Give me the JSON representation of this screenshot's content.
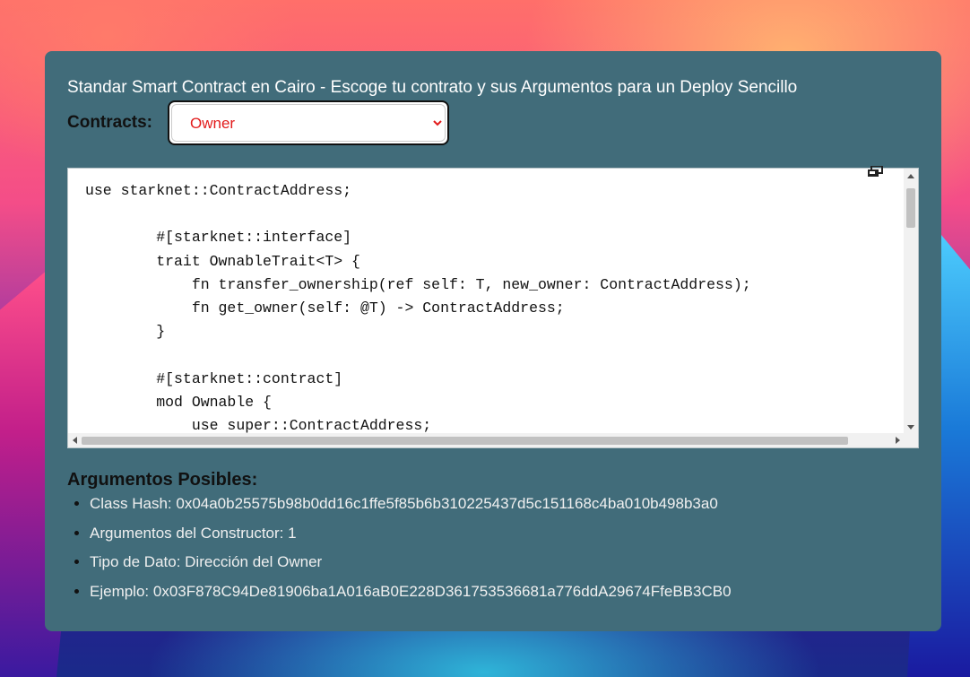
{
  "header": {
    "title": "Standar Smart Contract en Cairo - Escoge tu contrato y sus Argumentos para un Deploy Sencillo"
  },
  "contracts": {
    "label": "Contracts:",
    "selected": "Owner",
    "selected_color": "#e21b1b"
  },
  "code": {
    "text": "use starknet::ContractAddress;\n\n        #[starknet::interface]\n        trait OwnableTrait<T> {\n            fn transfer_ownership(ref self: T, new_owner: ContractAddress);\n            fn get_owner(self: @T) -> ContractAddress;\n        }\n\n        #[starknet::contract]\n        mod Ownable {\n            use super::ContractAddress;",
    "copy_icon": "copy-icon"
  },
  "args": {
    "title": "Argumentos Posibles:",
    "items": [
      "Class Hash: 0x04a0b25575b98b0dd16c1ffe5f85b6b310225437d5c151168c4ba010b498b3a0",
      "Argumentos del Constructor: 1",
      "Tipo de Dato: Dirección del Owner",
      "Ejemplo: 0x03F878C94De81906ba1A016aB0E228D361753536681a776ddA29674FfeBB3CB0"
    ]
  },
  "colors": {
    "panel": "#416c7a",
    "text_light": "#f0f0f0"
  }
}
